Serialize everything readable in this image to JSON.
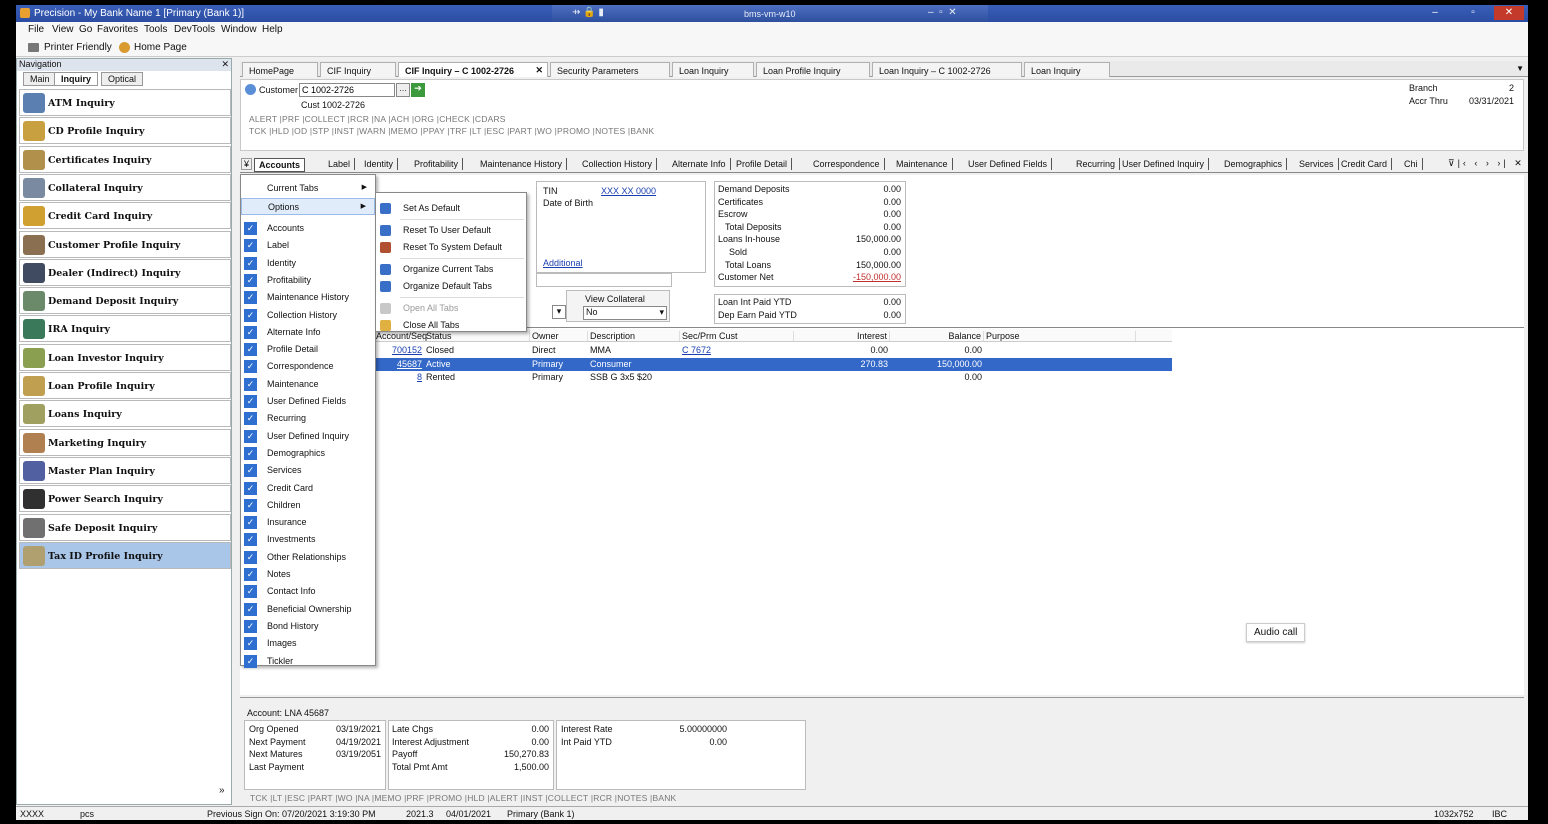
{
  "window": {
    "title": "Precision - My Bank Name 1 [Primary (Bank 1)]",
    "remote_host": "bms-vm-w10"
  },
  "menu": [
    "File",
    "View",
    "Go",
    "Favorites",
    "Tools",
    "DevTools",
    "Window",
    "Help"
  ],
  "toolbar": {
    "printer": "Printer Friendly",
    "home": "Home Page"
  },
  "nav": {
    "title": "Navigation",
    "tabs": [
      "Main",
      "Inquiry",
      "Optical"
    ],
    "items": [
      "ATM Inquiry",
      "CD Profile Inquiry",
      "Certificates Inquiry",
      "Collateral Inquiry",
      "Credit Card Inquiry",
      "Customer Profile Inquiry",
      "Dealer (Indirect) Inquiry",
      "Demand Deposit Inquiry",
      "IRA Inquiry",
      "Loan Investor Inquiry",
      "Loan Profile Inquiry",
      "Loans Inquiry",
      "Marketing Inquiry",
      "Master Plan Inquiry",
      "Power Search Inquiry",
      "Safe Deposit Inquiry",
      "Tax ID Profile Inquiry"
    ],
    "selected": "Tax ID Profile Inquiry"
  },
  "page_tabs": [
    "HomePage",
    "CIF Inquiry",
    "CIF Inquiry – C 1002-2726",
    "Security Parameters",
    "Loan Inquiry",
    "Loan Profile Inquiry",
    "Loan Inquiry – C 1002-2726",
    "Loan Inquiry"
  ],
  "cif": {
    "customer_label": "Customer",
    "customer_value": "C 1002-2726",
    "cust_name": "Cust 1002-2726",
    "codes1": "ALERT |PRF |COLLECT |RCR |NA |ACH |ORG |CHECK |CDARS",
    "codes2": "TCK |HLD |OD |STP |INST |WARN |MEMO |PPAY |TRF |LT |ESC |PART |WO |PROMO |NOTES |BANK",
    "branch_label": "Branch",
    "branch_value": "2",
    "accr_label": "Accr Thru",
    "accr_value": "03/31/2021"
  },
  "sub_tabs": [
    "Accounts",
    "Label",
    "Identity",
    "Profitability",
    "Maintenance History",
    "Collection History",
    "Alternate Info",
    "Profile Detail",
    "Correspondence",
    "Maintenance",
    "User Defined Fields",
    "Recurring",
    "User Defined Inquiry",
    "Demographics",
    "Services",
    "Credit Card",
    "Chi"
  ],
  "ident": {
    "tin_label": "TIN",
    "tin_value": "XXX XX 0000",
    "dob_label": "Date of Birth",
    "additional": "Additional",
    "view_collateral": "View Collateral",
    "select_value": "No"
  },
  "totals": [
    [
      "Demand Deposits",
      "0.00"
    ],
    [
      "Certificates",
      "0.00"
    ],
    [
      "Escrow",
      "0.00"
    ],
    [
      "Total Deposits",
      "0.00"
    ],
    [
      "Loans In-house",
      "150,000.00"
    ],
    [
      "Sold",
      "0.00"
    ],
    [
      "Total Loans",
      "150,000.00"
    ],
    [
      "Customer Net",
      "-150,000.00"
    ]
  ],
  "ytd": [
    [
      "Loan Int Paid YTD",
      "0.00"
    ],
    [
      "Dep Earn Paid YTD",
      "0.00"
    ]
  ],
  "grid": {
    "headers": [
      "Account/Seq",
      "Status",
      "Owner",
      "Description",
      "Sec/Prm Cust",
      "Interest",
      "Balance",
      "Purpose"
    ],
    "rows": [
      [
        "700152",
        "Closed",
        "Direct",
        "MMA",
        "C 7672",
        "0.00",
        "0.00",
        ""
      ],
      [
        "45687",
        "Active",
        "Primary",
        "Consumer",
        "",
        "270.83",
        "150,000.00",
        ""
      ],
      [
        "8",
        "Rented",
        "Primary",
        "SSB G 3x5 $20",
        "",
        "",
        "0.00",
        ""
      ]
    ]
  },
  "context_menu": {
    "current_tabs": "Current Tabs",
    "options": "Options",
    "checked": [
      "Accounts",
      "Label",
      "Identity",
      "Profitability",
      "Maintenance History",
      "Collection History",
      "Alternate Info",
      "Profile Detail",
      "Correspondence",
      "Maintenance",
      "User Defined Fields",
      "Recurring",
      "User Defined Inquiry",
      "Demographics",
      "Services",
      "Credit Card",
      "Children",
      "Insurance",
      "Investments",
      "Other Relationships",
      "Notes",
      "Contact Info",
      "Beneficial Ownership",
      "Bond History",
      "Images",
      "Tickler"
    ]
  },
  "options_menu": [
    "Set As Default",
    "Reset To User Default",
    "Reset To System Default",
    "Organize Current Tabs",
    "Organize Default Tabs",
    "Open All Tabs",
    "Close All Tabs"
  ],
  "detail": {
    "account": "Account: LNA 45687",
    "col1": [
      [
        "Org Opened",
        "03/19/2021"
      ],
      [
        "Next Payment",
        "04/19/2021"
      ],
      [
        "Next Matures",
        "03/19/2051"
      ],
      [
        "Last Payment",
        ""
      ]
    ],
    "col2": [
      [
        "Late Chgs",
        "0.00"
      ],
      [
        "Interest Adjustment",
        "0.00"
      ],
      [
        "Payoff",
        "150,270.83"
      ],
      [
        "Total Pmt Amt",
        "1,500.00"
      ]
    ],
    "col3": [
      [
        "Interest Rate",
        "5.00000000"
      ],
      [
        "Int Paid YTD",
        "0.00"
      ]
    ],
    "codes": "TCK |LT |ESC |PART |WO |NA |MEMO |PRF |PROMO |HLD |ALERT |INST |COLLECT |RCR |NOTES |BANK"
  },
  "audio_call": "Audio call",
  "status": {
    "user": "XXXX",
    "pcs": "pcs",
    "signon": "Previous Sign On: 07/20/2021 3:19:30 PM",
    "version": "2021.3",
    "date": "04/01/2021",
    "bank": "Primary (Bank 1)",
    "res": "1032x752",
    "ibc": "IBC"
  }
}
